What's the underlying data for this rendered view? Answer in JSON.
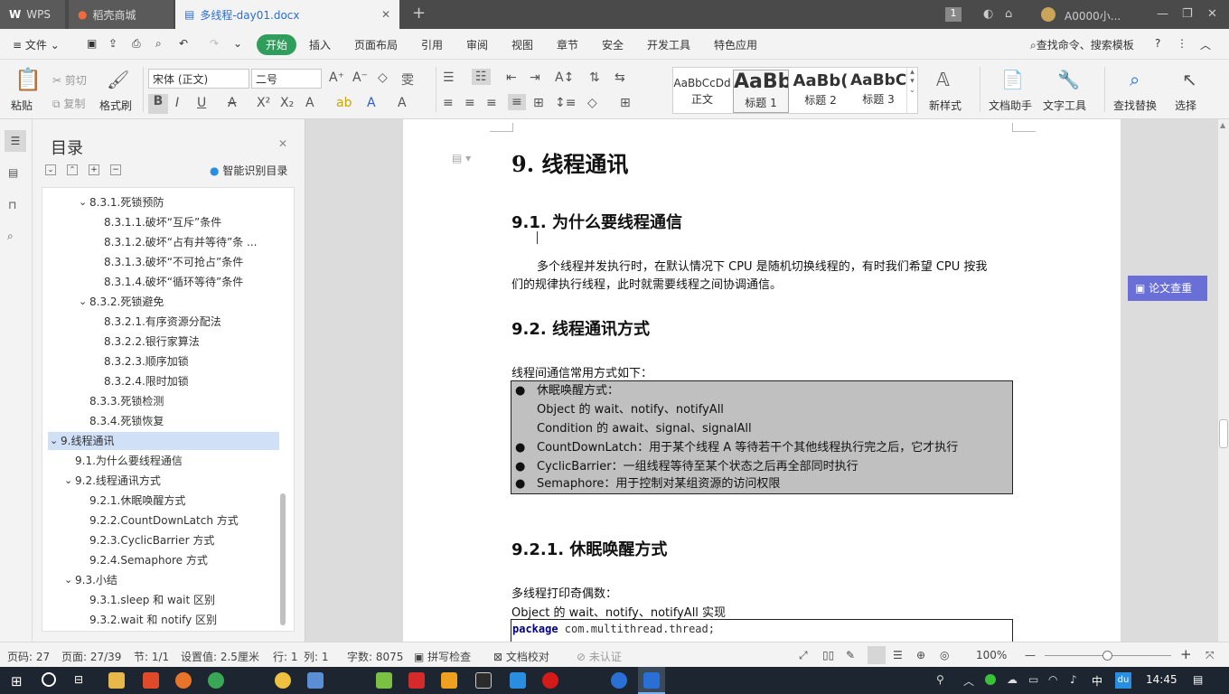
{
  "titlebar": {
    "app": "WPS",
    "tabs": [
      {
        "label": "稻壳商城"
      },
      {
        "label": "多线程-day01.docx"
      }
    ],
    "user": "A0000小...",
    "badge": "1"
  },
  "menu": {
    "file": "文件",
    "items": [
      "开始",
      "插入",
      "页面布局",
      "引用",
      "审阅",
      "视图",
      "章节",
      "安全",
      "开发工具",
      "特色应用"
    ],
    "search": "查找命令、搜索模板"
  },
  "ribbon": {
    "paste": "粘贴",
    "cut": "剪切",
    "copy": "复制",
    "format_painter": "格式刷",
    "font": "宋体 (正文)",
    "size": "二号",
    "styles": [
      {
        "sample": "AaBbCcDd",
        "label": "正文"
      },
      {
        "sample": "AaBb",
        "label": "标题 1"
      },
      {
        "sample": "AaBb(",
        "label": "标题 2"
      },
      {
        "sample": "AaBbC",
        "label": "标题 3"
      }
    ],
    "new_style": "新样式",
    "doc_helper": "文档助手",
    "text_tools": "文字工具",
    "find_replace": "查找替换",
    "select": "选择"
  },
  "toc": {
    "title": "目录",
    "smart": "智能识别目录",
    "items": [
      {
        "text": "8.3.1.死锁预防",
        "level": 2,
        "arrow": "⌄"
      },
      {
        "text": "8.3.1.1.破坏“互斥”条件",
        "level": 3
      },
      {
        "text": "8.3.1.2.破坏“占有并等待”条 ...",
        "level": 3
      },
      {
        "text": "8.3.1.3.破坏“不可抢占”条件",
        "level": 3
      },
      {
        "text": "8.3.1.4.破坏“循环等待”条件",
        "level": 3
      },
      {
        "text": "8.3.2.死锁避免",
        "level": 2,
        "arrow": "⌄"
      },
      {
        "text": "8.3.2.1.有序资源分配法",
        "level": 3
      },
      {
        "text": "8.3.2.2.银行家算法",
        "level": 3
      },
      {
        "text": "8.3.2.3.顺序加锁",
        "level": 3
      },
      {
        "text": "8.3.2.4.限时加锁",
        "level": 3
      },
      {
        "text": "8.3.3.死锁检测",
        "level": 2
      },
      {
        "text": "8.3.4.死锁恢复",
        "level": 2
      },
      {
        "text": "9.线程通讯",
        "level": 0,
        "arrow": "⌄",
        "selected": true
      },
      {
        "text": "9.1.为什么要线程通信",
        "level": 1
      },
      {
        "text": "9.2.线程通讯方式",
        "level": 1,
        "arrow": "⌄"
      },
      {
        "text": "9.2.1.休眠唤醒方式",
        "level": 2
      },
      {
        "text": "9.2.2.CountDownLatch 方式",
        "level": 2
      },
      {
        "text": "9.2.3.CyclicBarrier 方式",
        "level": 2
      },
      {
        "text": "9.2.4.Semaphore 方式",
        "level": 2
      },
      {
        "text": "9.3.小结",
        "level": 1,
        "arrow": "⌄"
      },
      {
        "text": "9.3.1.sleep 和 wait 区别",
        "level": 2
      },
      {
        "text": "9.3.2.wait 和 notify 区别",
        "level": 2
      }
    ]
  },
  "doc": {
    "h1": "9. 线程通讯",
    "h2a": "9.1. 为什么要线程通信",
    "para1_l1": "多个线程并发执行时，在默认情况下 CPU 是随机切换线程的，有时我们希望 CPU 按我",
    "para1_l2": "们的规律执行线程，此时就需要线程之间协调通信。",
    "h2b": "9.2. 线程通讯方式",
    "intro": "线程间通信常用方式如下：",
    "b1": "休眠唤醒方式：",
    "b1a": "Object 的 wait、notify、notifyAll",
    "b1b": "Condition 的 await、signal、signalAll",
    "b2": "CountDownLatch：用于某个线程 A 等待若干个其他线程执行完之后，它才执行",
    "b3": "CyclicBarrier：一组线程等待至某个状态之后再全部同时执行",
    "b4": "Semaphore：用于控制对某组资源的访问权限",
    "h3": "9.2.1. 休眠唤醒方式",
    "p2": "多线程打印奇偶数：",
    "p3": "Object 的 wait、notify、notifyAll 实现",
    "code_kw": "package",
    "code_rest": " com.multithread.thread;",
    "side_btn": "论文查重"
  },
  "status": {
    "page": "页码: 27",
    "pages": "页面: 27/39",
    "section": "节: 1/1",
    "setting": "设置值: 2.5厘米",
    "row": "行: 1",
    "col": "列: 1",
    "words": "字数: 8075",
    "spell": "拼写检查",
    "compare": "文档校对",
    "cert": "未认证",
    "zoom": "100%"
  },
  "taskbar": {
    "time": "14:45",
    "ime": "中"
  }
}
